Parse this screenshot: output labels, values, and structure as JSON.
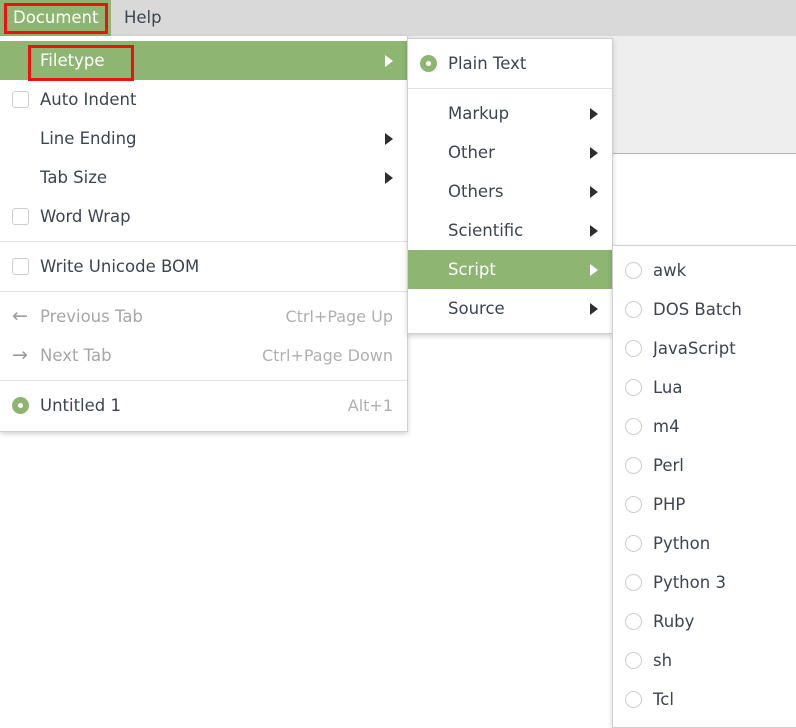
{
  "menubar": {
    "items": [
      {
        "label": "Document",
        "active": true
      },
      {
        "label": "Help",
        "active": false
      }
    ]
  },
  "document_menu": {
    "items": [
      {
        "label": "Filetype",
        "icon": "none",
        "accel": "",
        "arrow": true,
        "state": "highlight"
      },
      {
        "label": "Auto Indent",
        "icon": "checkbox-off",
        "accel": "",
        "arrow": false,
        "state": "normal"
      },
      {
        "label": "Line Ending",
        "icon": "none",
        "accel": "",
        "arrow": true,
        "state": "normal"
      },
      {
        "label": "Tab Size",
        "icon": "none",
        "accel": "",
        "arrow": true,
        "state": "normal"
      },
      {
        "label": "Word Wrap",
        "icon": "checkbox-off",
        "accel": "",
        "arrow": false,
        "state": "normal"
      },
      {
        "separator": true
      },
      {
        "label": "Write Unicode BOM",
        "icon": "checkbox-off",
        "accel": "",
        "arrow": false,
        "state": "normal"
      },
      {
        "separator": true
      },
      {
        "label": "Previous Tab",
        "icon": "arrow-left",
        "accel": "Ctrl+Page Up",
        "arrow": false,
        "state": "disabled"
      },
      {
        "label": "Next Tab",
        "icon": "arrow-right",
        "accel": "Ctrl+Page Down",
        "arrow": false,
        "state": "disabled"
      },
      {
        "separator": true
      },
      {
        "label": "Untitled 1",
        "icon": "radio-on",
        "accel": "Alt+1",
        "arrow": false,
        "state": "normal"
      }
    ]
  },
  "filetype_menu": {
    "items": [
      {
        "label": "Plain Text",
        "icon": "radio-on",
        "arrow": false,
        "state": "normal"
      },
      {
        "separator": true
      },
      {
        "label": "Markup",
        "icon": "none",
        "arrow": true,
        "state": "normal"
      },
      {
        "label": "Other",
        "icon": "none",
        "arrow": true,
        "state": "normal"
      },
      {
        "label": "Others",
        "icon": "none",
        "arrow": true,
        "state": "normal"
      },
      {
        "label": "Scientific",
        "icon": "none",
        "arrow": true,
        "state": "normal"
      },
      {
        "label": "Script",
        "icon": "none",
        "arrow": true,
        "state": "highlight"
      },
      {
        "label": "Source",
        "icon": "none",
        "arrow": true,
        "state": "normal"
      }
    ]
  },
  "script_menu": {
    "items": [
      {
        "label": "awk",
        "icon": "radio-off",
        "state": "normal"
      },
      {
        "label": "DOS Batch",
        "icon": "radio-off",
        "state": "normal"
      },
      {
        "label": "JavaScript",
        "icon": "radio-off",
        "state": "normal"
      },
      {
        "label": "Lua",
        "icon": "radio-off",
        "state": "normal"
      },
      {
        "label": "m4",
        "icon": "radio-off",
        "state": "normal"
      },
      {
        "label": "Perl",
        "icon": "radio-off",
        "state": "normal"
      },
      {
        "label": "PHP",
        "icon": "radio-off",
        "state": "normal"
      },
      {
        "label": "Python",
        "icon": "radio-off",
        "state": "normal"
      },
      {
        "label": "Python 3",
        "icon": "radio-off",
        "state": "normal"
      },
      {
        "label": "Ruby",
        "icon": "radio-off",
        "state": "normal"
      },
      {
        "label": "sh",
        "icon": "radio-off",
        "state": "normal"
      },
      {
        "label": "Tcl",
        "icon": "radio-off",
        "state": "normal"
      }
    ]
  },
  "annotations": [
    {
      "target": "Document"
    },
    {
      "target": "Filetype"
    }
  ],
  "colors": {
    "accent_green": "#8fb573",
    "menubar_bg": "#d9d9d9",
    "toolbar_bg": "#eeeeee",
    "menu_bg": "#ffffff",
    "text": "#3d4451",
    "disabled_text": "#a6a6a6",
    "accel_text": "#b0b0b0",
    "annotation_red": "#ee1111"
  }
}
